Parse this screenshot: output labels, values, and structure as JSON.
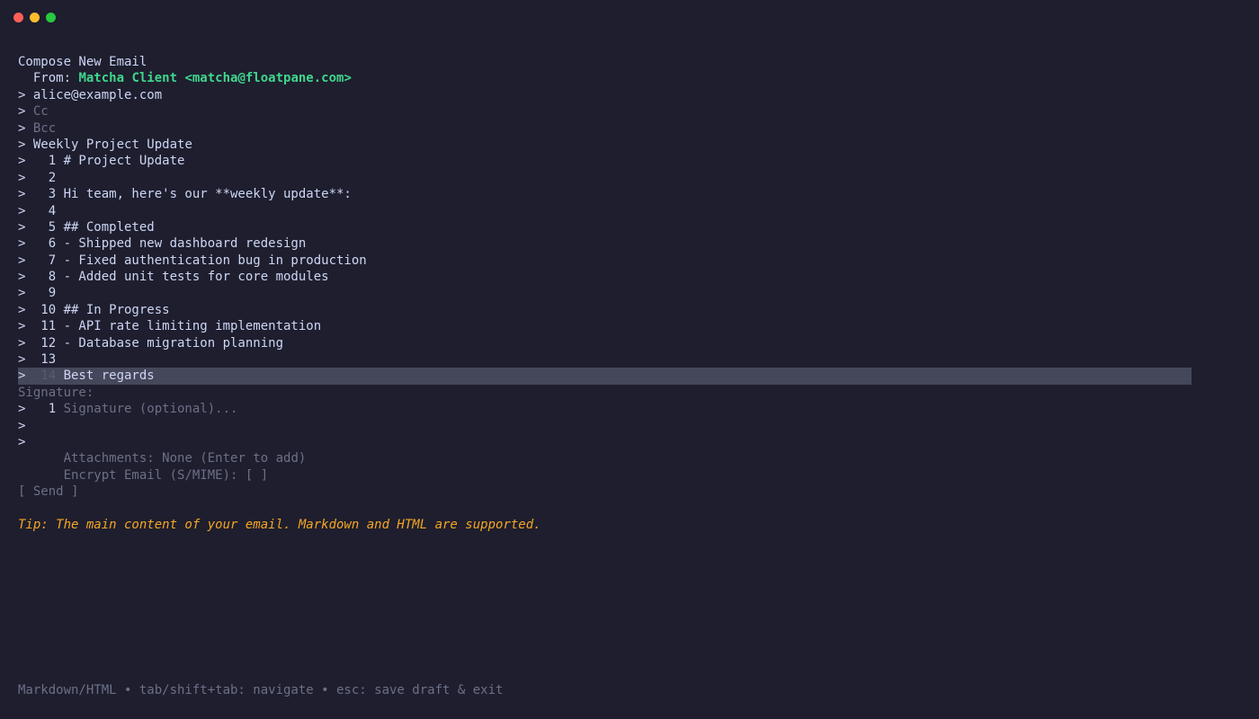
{
  "window": {
    "controls": [
      "close",
      "minimize",
      "maximize"
    ]
  },
  "compose": {
    "title": "Compose New Email",
    "from_label": "  From: ",
    "from_value": "Matcha Client <matcha@floatpane.com>",
    "prompt_symbol": ">",
    "to_value": "alice@example.com",
    "cc_placeholder": "Cc",
    "bcc_placeholder": "Bcc",
    "subject_value": "Weekly Project Update",
    "body_lines": [
      {
        "num": "1",
        "text": "# Project Update"
      },
      {
        "num": "2",
        "text": ""
      },
      {
        "num": "3",
        "text": "Hi team, here's our **weekly update**:"
      },
      {
        "num": "4",
        "text": ""
      },
      {
        "num": "5",
        "text": "## Completed"
      },
      {
        "num": "6",
        "text": "- Shipped new dashboard redesign"
      },
      {
        "num": "7",
        "text": "- Fixed authentication bug in production"
      },
      {
        "num": "8",
        "text": "- Added unit tests for core modules"
      },
      {
        "num": "9",
        "text": ""
      },
      {
        "num": "10",
        "text": "## In Progress"
      },
      {
        "num": "11",
        "text": "- API rate limiting implementation"
      },
      {
        "num": "12",
        "text": "- Database migration planning"
      },
      {
        "num": "13",
        "text": ""
      },
      {
        "num": "14",
        "text": "Best regards"
      }
    ],
    "signature_label": "Signature:",
    "signature_num": "1",
    "signature_placeholder": "Signature (optional)...",
    "attachments_label": "Attachments: None (Enter to add)",
    "encrypt_label": "Encrypt Email (S/MIME): [ ]",
    "send_button": "[ Send ]",
    "tip": "Tip: The main content of your email. Markdown and HTML are supported."
  },
  "footer": {
    "help": "Markdown/HTML • tab/shift+tab: navigate • esc: save draft & exit"
  },
  "colors": {
    "background": "#1e1e2e",
    "accent_green": "#40d68c",
    "tip_orange": "#f5a623",
    "highlight": "#45475a"
  }
}
